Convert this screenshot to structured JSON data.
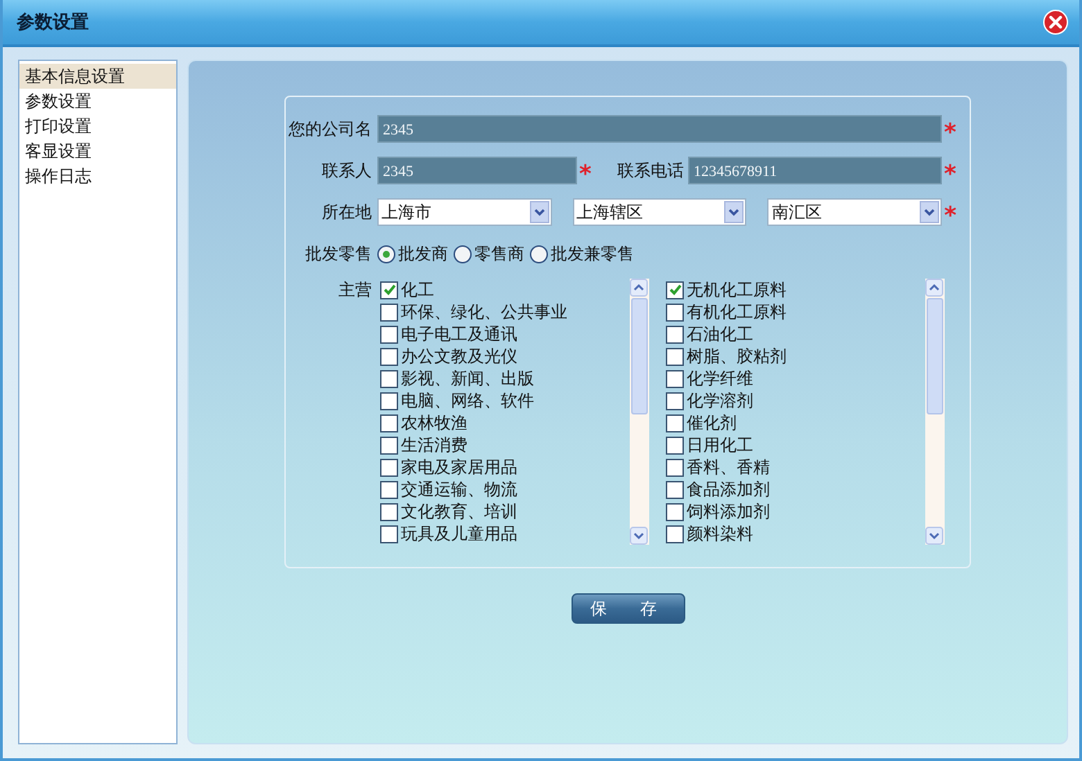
{
  "window": {
    "title": "参数设置"
  },
  "sidebar": {
    "items": [
      {
        "label": "基本信息设置",
        "selected": true
      },
      {
        "label": "参数设置",
        "selected": false
      },
      {
        "label": "打印设置",
        "selected": false
      },
      {
        "label": "客显设置",
        "selected": false
      },
      {
        "label": "操作日志",
        "selected": false
      }
    ]
  },
  "form": {
    "company_name": {
      "label": "您的公司名",
      "value": "2345",
      "required_mark": "*"
    },
    "contact": {
      "label": "联系人",
      "value": "2345",
      "required_mark": "*"
    },
    "phone": {
      "label": "联系电话",
      "value": "12345678911",
      "required_mark": "*"
    },
    "location": {
      "label": "所在地",
      "selects": [
        {
          "value": "上海市"
        },
        {
          "value": "上海辖区"
        },
        {
          "value": "南汇区",
          "required_mark": "*"
        }
      ]
    },
    "sales_type": {
      "label": "批发零售",
      "options": [
        {
          "label": "批发商",
          "selected": true
        },
        {
          "label": "零售商",
          "selected": false
        },
        {
          "label": "批发兼零售",
          "selected": false
        }
      ]
    },
    "main_business": {
      "label": "主营",
      "lists": [
        {
          "items": [
            {
              "label": "化工",
              "checked": true
            },
            {
              "label": "环保、绿化、公共事业",
              "checked": false
            },
            {
              "label": "电子电工及通讯",
              "checked": false
            },
            {
              "label": "办公文教及光仪",
              "checked": false
            },
            {
              "label": "影视、新闻、出版",
              "checked": false
            },
            {
              "label": "电脑、网络、软件",
              "checked": false
            },
            {
              "label": "农林牧渔",
              "checked": false
            },
            {
              "label": "生活消费",
              "checked": false
            },
            {
              "label": "家电及家居用品",
              "checked": false
            },
            {
              "label": "交通运输、物流",
              "checked": false
            },
            {
              "label": "文化教育、培训",
              "checked": false
            },
            {
              "label": "玩具及儿童用品",
              "checked": false
            }
          ]
        },
        {
          "items": [
            {
              "label": "无机化工原料",
              "checked": true
            },
            {
              "label": "有机化工原料",
              "checked": false
            },
            {
              "label": "石油化工",
              "checked": false
            },
            {
              "label": "树脂、胶粘剂",
              "checked": false
            },
            {
              "label": "化学纤维",
              "checked": false
            },
            {
              "label": "化学溶剂",
              "checked": false
            },
            {
              "label": "催化剂",
              "checked": false
            },
            {
              "label": "日用化工",
              "checked": false
            },
            {
              "label": "香料、香精",
              "checked": false
            },
            {
              "label": "食品添加剂",
              "checked": false
            },
            {
              "label": "饲料添加剂",
              "checked": false
            },
            {
              "label": "颜料染料",
              "checked": false
            }
          ]
        }
      ]
    }
  },
  "save_button": {
    "label": "保 存"
  }
}
